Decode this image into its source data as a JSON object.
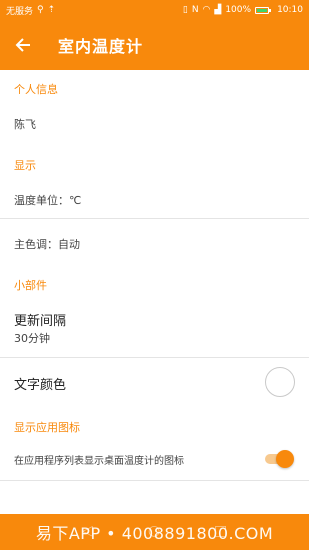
{
  "status_bar": {
    "carrier": "无服务",
    "battery": "100%",
    "time": "10:10"
  },
  "toolbar": {
    "title": "室内温度计"
  },
  "sections": {
    "personal": {
      "header": "个人信息",
      "name": "陈飞"
    },
    "display": {
      "header": "显示",
      "temp_unit": "温度单位：℃",
      "theme": "主色调：自动"
    },
    "widget": {
      "header": "小部件",
      "update_title": "更新间隔",
      "update_value": "30分钟",
      "text_color_title": "文字颜色"
    },
    "app_icon": {
      "header": "显示应用图标",
      "toggle_label": "在应用程序列表显示桌面温度计的图标",
      "toggle_on": true
    }
  },
  "watermark": "易下APP • 4008891800.COM",
  "colors": {
    "accent": "#f8890c",
    "toggle_track": "#f7c98f"
  }
}
